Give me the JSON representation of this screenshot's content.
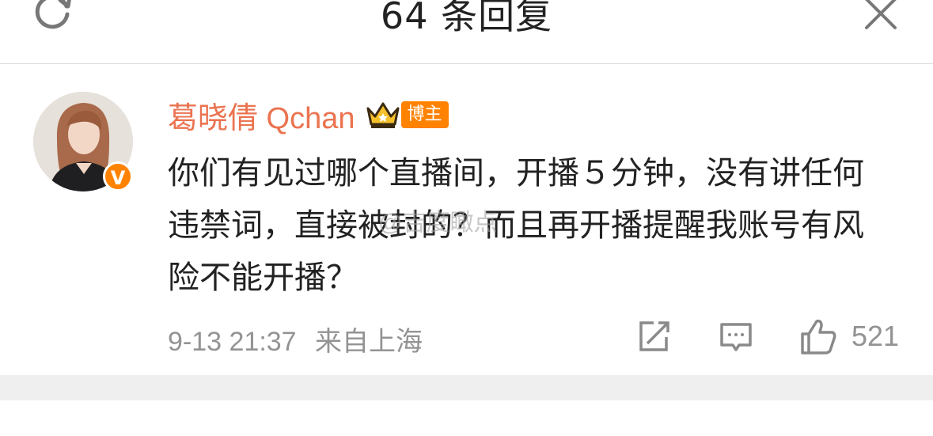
{
  "header": {
    "title": "64 条回复"
  },
  "comment": {
    "username": "葛晓倩 Qchan",
    "role_badge": "博主",
    "verified_mark": "V",
    "text": "你们有见过哪个直播间，开播５分钟，没有讲任何违禁词，直接被封的？而且再开播提醒我账号有风险不能开播？",
    "watermark": "@吉度瞰点",
    "timestamp": "9-13 21:37",
    "location": "来自上海",
    "like_count": "521"
  },
  "icons": {
    "refresh": "refresh-icon",
    "close": "close-icon",
    "crown": "crown-icon",
    "share": "share-icon",
    "comment": "comment-icon",
    "like": "thumbs-up-icon"
  },
  "colors": {
    "username": "#eb7350",
    "badge": "#ff8200",
    "meta": "#939393"
  }
}
